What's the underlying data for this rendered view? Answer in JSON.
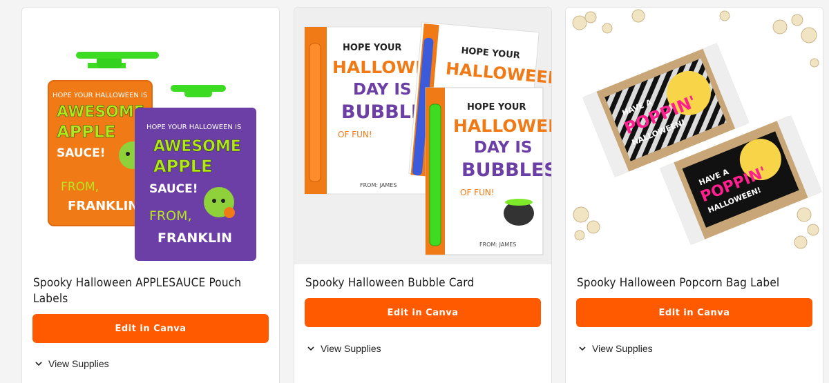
{
  "cards": [
    {
      "title": "Spooky Halloween APPLESAUCE Pouch Labels",
      "button": "Edit in Canva",
      "supplies": "View Supplies",
      "image": {
        "front": [
          "HOPE YOUR HALLOWEEN IS",
          "AWESOME",
          "APPLE",
          "SAUCE!",
          "FROM,",
          "FRANKLIN"
        ],
        "back": [
          "HOPE YOUR HALLOWEEN IS",
          "AWESOME",
          "APPLE",
          "SAUCE!",
          "FROM,",
          "FRANKLIN"
        ]
      }
    },
    {
      "title": "Spooky Halloween Bubble Card",
      "button": "Edit in Canva",
      "supplies": "View Supplies",
      "image": {
        "lines": [
          "HOPE YOUR",
          "HALLOWEEN",
          "DAY IS",
          "BUBBLES",
          "OF FUN!",
          "FROM: JAMES"
        ]
      }
    },
    {
      "title": "Spooky Halloween Popcorn Bag Label",
      "button": "Edit in Canva",
      "supplies": "View Supplies",
      "image": {
        "lines": [
          "HAVE A",
          "POPPIN'",
          "HALLOWEEN!"
        ]
      }
    }
  ],
  "colors": {
    "accent": "#ff5a00",
    "orange_card": "#f07a16",
    "purple_card": "#6b3fa6",
    "green": "#3ddc23"
  },
  "icons": {
    "chevron": "chevron-down-icon"
  }
}
